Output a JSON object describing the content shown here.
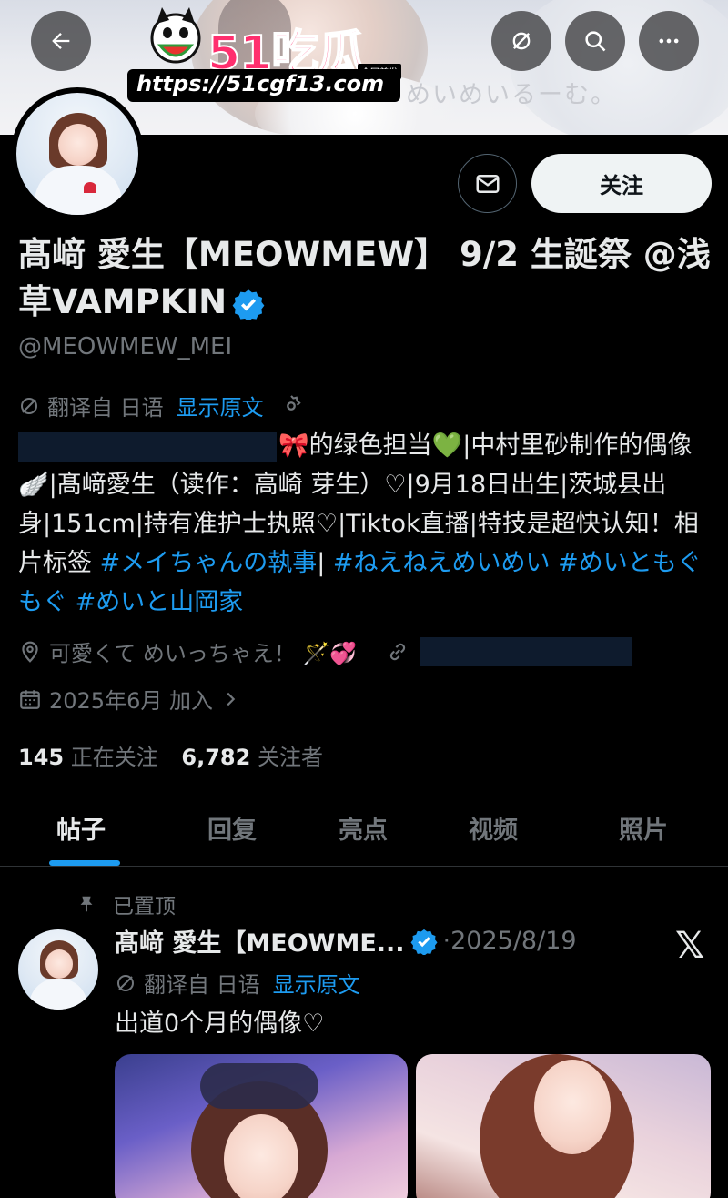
{
  "banner": {
    "text": "めいめいるーむ。"
  },
  "watermark": {
    "brand": "51吃瓜",
    "tag": "全网首发",
    "url": "https://51cgf13.com"
  },
  "nav": {
    "back_icon": "arrow-left-icon",
    "grok_icon": "grok-icon",
    "search_icon": "search-icon",
    "more_icon": "more-icon"
  },
  "profile": {
    "name": "髙﨑 愛生【MEOWMEW】 9/2 生誕祭 @浅草VAMPKIN",
    "handle": "@MEOWMEW_MEI",
    "follow_label": "关注",
    "translate_label": "翻译自 日语",
    "show_original": "显示原文",
    "bio": {
      "part1": "🎀的绿色担当💚|中村里砂制作的偶像🪽|髙﨑愛生（读作：高崎 芽生）♡|9月18日出生|茨城县出身|151cm|持有准护士执照♡|Tiktok直播|特技是超快认知！相片标签 ",
      "hashtag1": "#メイちゃんの執事",
      "sep1": "| ",
      "hashtag2": "#ねえねえめいめい",
      "sep2": " ",
      "hashtag3": "#めいともぐもぐ",
      "sep3": " ",
      "hashtag4": "#めいと山岡家"
    },
    "location": "可愛くて めいっちゃえ！ 🪄💞",
    "joined": "2025年6月 加入",
    "following_count": "145",
    "following_label": "正在关注",
    "followers_count": "6,782",
    "followers_label": "关注者"
  },
  "tabs": [
    {
      "label": "帖子",
      "active": true
    },
    {
      "label": "回复",
      "active": false
    },
    {
      "label": "亮点",
      "active": false
    },
    {
      "label": "视频",
      "active": false
    },
    {
      "label": "照片",
      "active": false
    }
  ],
  "post": {
    "pinned_label": "已置顶",
    "author": "髙﨑 愛生【MEOWME...",
    "date": "·2025/8/19",
    "source_icon": "x-logo",
    "translate_label": "翻译自 日语",
    "show_original": "显示原文",
    "text": "出道0个月的偶像♡"
  },
  "colors": {
    "accent": "#1d9bf0",
    "muted": "#71767b",
    "text": "#e7e9ea",
    "bg": "#000000"
  }
}
